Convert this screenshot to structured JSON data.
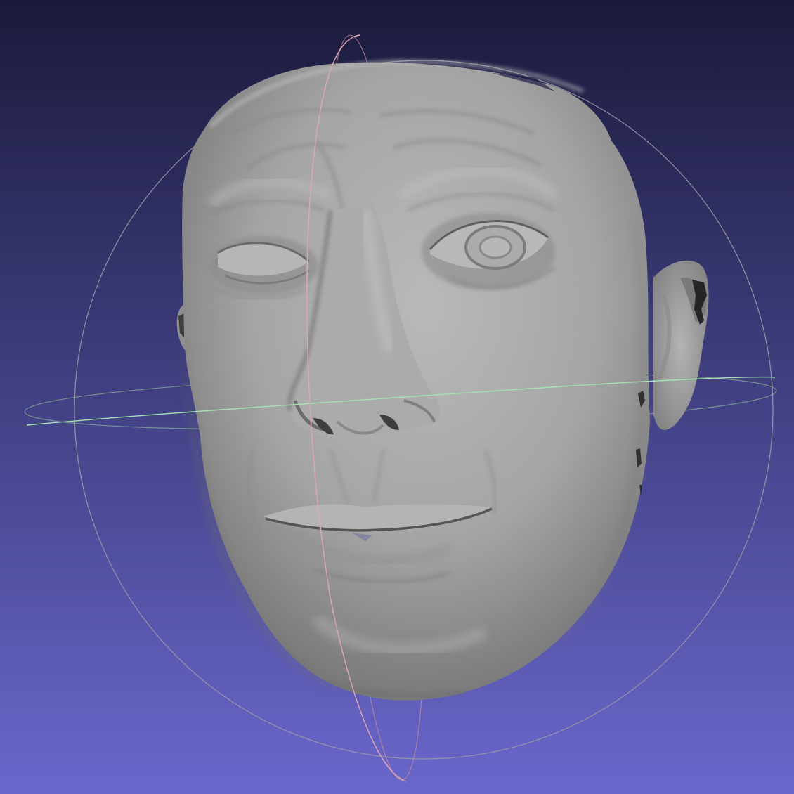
{
  "viewport": {
    "background_top": "#1a1a3b",
    "background_bottom": "#6a67cc"
  },
  "model": {
    "type": "scanned-face-mesh",
    "surface_color": "#a9a9a9",
    "shadow_color": "#5e5e5e"
  },
  "trackball": {
    "visible": true,
    "horizontal_ring_color": "#a6e3b4",
    "vertical_ring_color": "#e0a8b0",
    "sphere_ring_color": "#9a9aa8"
  }
}
